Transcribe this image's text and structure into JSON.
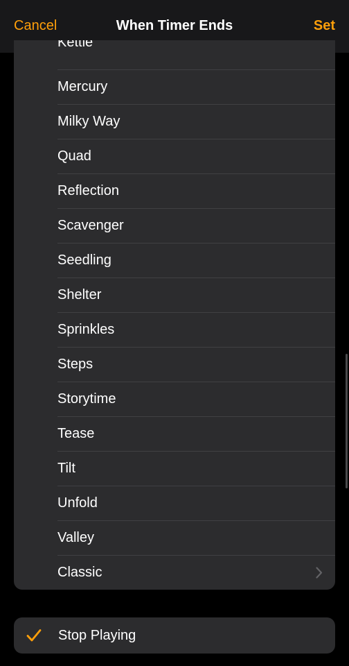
{
  "header": {
    "cancel": "Cancel",
    "title": "When Timer Ends",
    "set": "Set"
  },
  "sounds": {
    "partial_top": "Kettle",
    "items": [
      "Mercury",
      "Milky Way",
      "Quad",
      "Reflection",
      "Scavenger",
      "Seedling",
      "Shelter",
      "Sprinkles",
      "Steps",
      "Storytime",
      "Tease",
      "Tilt",
      "Unfold",
      "Valley"
    ],
    "classic": "Classic"
  },
  "stop": {
    "label": "Stop Playing",
    "selected": true
  }
}
